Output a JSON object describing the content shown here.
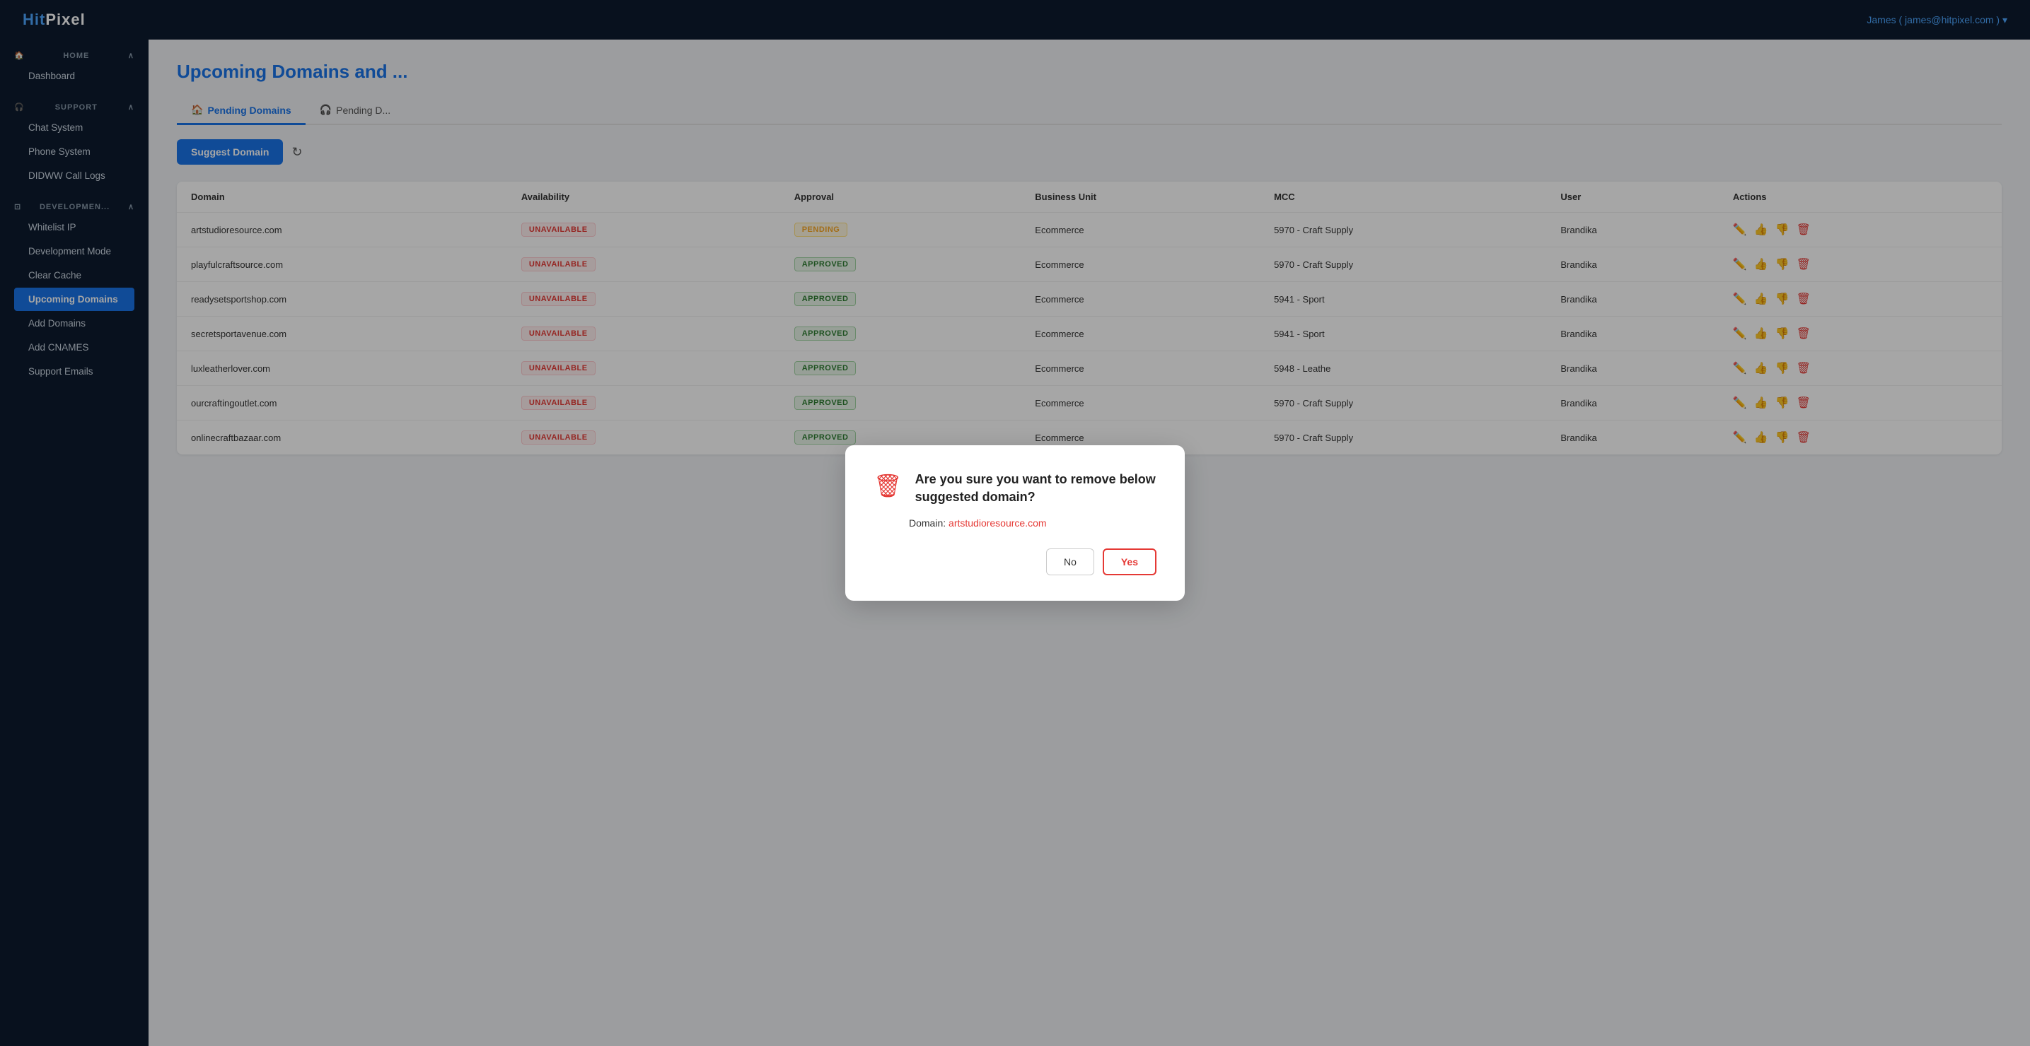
{
  "header": {
    "logo_text": "HitPixel",
    "user_display": "James ( james@hitpixel.com ) ▾"
  },
  "sidebar": {
    "home_section": "HOME",
    "home_items": [
      {
        "label": "Dashboard",
        "active": false
      }
    ],
    "support_section": "SUPPORT",
    "support_items": [
      {
        "label": "Chat System",
        "active": false
      },
      {
        "label": "Phone System",
        "active": false
      },
      {
        "label": "DIDWW Call Logs",
        "active": false
      }
    ],
    "dev_section": "DEVELOPMEN...",
    "dev_items": [
      {
        "label": "Whitelist IP",
        "active": false
      },
      {
        "label": "Development Mode",
        "active": false
      },
      {
        "label": "Clear Cache",
        "active": false
      },
      {
        "label": "Upcoming Domains",
        "active": true
      },
      {
        "label": "Add Domains",
        "active": false
      },
      {
        "label": "Add CNAMES",
        "active": false
      },
      {
        "label": "Support Emails",
        "active": false
      }
    ]
  },
  "page": {
    "title": "Upcoming Domains and ...",
    "tabs": [
      {
        "label": "Pending Domains",
        "active": true,
        "icon": "🏠"
      },
      {
        "label": "Pending D...",
        "active": false,
        "icon": "🎧"
      }
    ],
    "suggest_button": "Suggest Domain",
    "refresh_icon": "↻"
  },
  "table": {
    "columns": [
      "Domain",
      "Availability",
      "Approval",
      "Business Unit",
      "MCC",
      "User",
      "Actions"
    ],
    "rows": [
      {
        "domain": "artstudioresource.com",
        "availability": "UNAVAILABLE",
        "approval": "PENDING",
        "business_unit": "Ecommerce",
        "mcc": "5970 - Craft Supply",
        "user": "Brandika"
      },
      {
        "domain": "playfulcraftsource.com",
        "availability": "UNAVAILABLE",
        "approval": "APPROVED",
        "business_unit": "Ecommerce",
        "mcc": "5970 - Craft Supply",
        "user": "Brandika"
      },
      {
        "domain": "readysetsportshop.com",
        "availability": "UNAVAILABLE",
        "approval": "APPROVED",
        "business_unit": "Ecommerce",
        "mcc": "5941 - Sport",
        "user": "Brandika"
      },
      {
        "domain": "secretsportavenue.com",
        "availability": "UNAVAILABLE",
        "approval": "APPROVED",
        "business_unit": "Ecommerce",
        "mcc": "5941 - Sport",
        "user": "Brandika"
      },
      {
        "domain": "luxleatherlover.com",
        "availability": "UNAVAILABLE",
        "approval": "APPROVED",
        "business_unit": "Ecommerce",
        "mcc": "5948 - Leathe",
        "user": "Brandika"
      },
      {
        "domain": "ourcraftingoutlet.com",
        "availability": "UNAVAILABLE",
        "approval": "APPROVED",
        "business_unit": "Ecommerce",
        "mcc": "5970 - Craft Supply",
        "user": "Brandika"
      },
      {
        "domain": "onlinecraftbazaar.com",
        "availability": "UNAVAILABLE",
        "approval": "APPROVED",
        "business_unit": "Ecommerce",
        "mcc": "5970 - Craft Supply",
        "user": "Brandika"
      }
    ]
  },
  "modal": {
    "title": "Are you sure you want to remove below suggested domain?",
    "domain_label": "Domain:",
    "domain_value": "artstudioresource.com",
    "btn_no": "No",
    "btn_yes": "Yes"
  }
}
